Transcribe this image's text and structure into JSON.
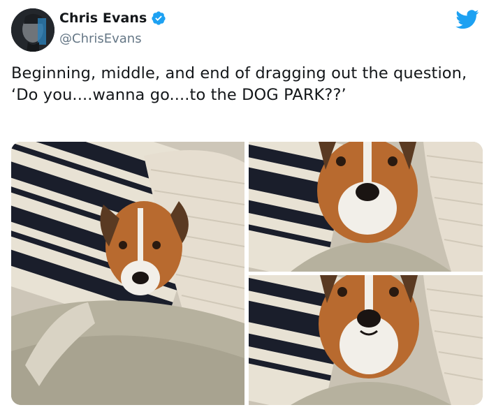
{
  "tweet": {
    "author_name": "Chris Evans",
    "handle": "@ChrisEvans",
    "text": "Beginning, middle, and end of dragging out the question, ‘Do you....wanna go....to the DOG PARK??’"
  },
  "icons": {
    "verified": "verified-badge-icon",
    "brand": "twitter-bird-icon"
  },
  "colors": {
    "brand_blue": "#1da1f2",
    "text": "#14171a",
    "secondary_text": "#657786"
  },
  "media": {
    "photos": [
      {
        "name": "photo-beginning"
      },
      {
        "name": "photo-middle"
      },
      {
        "name": "photo-end"
      }
    ]
  }
}
